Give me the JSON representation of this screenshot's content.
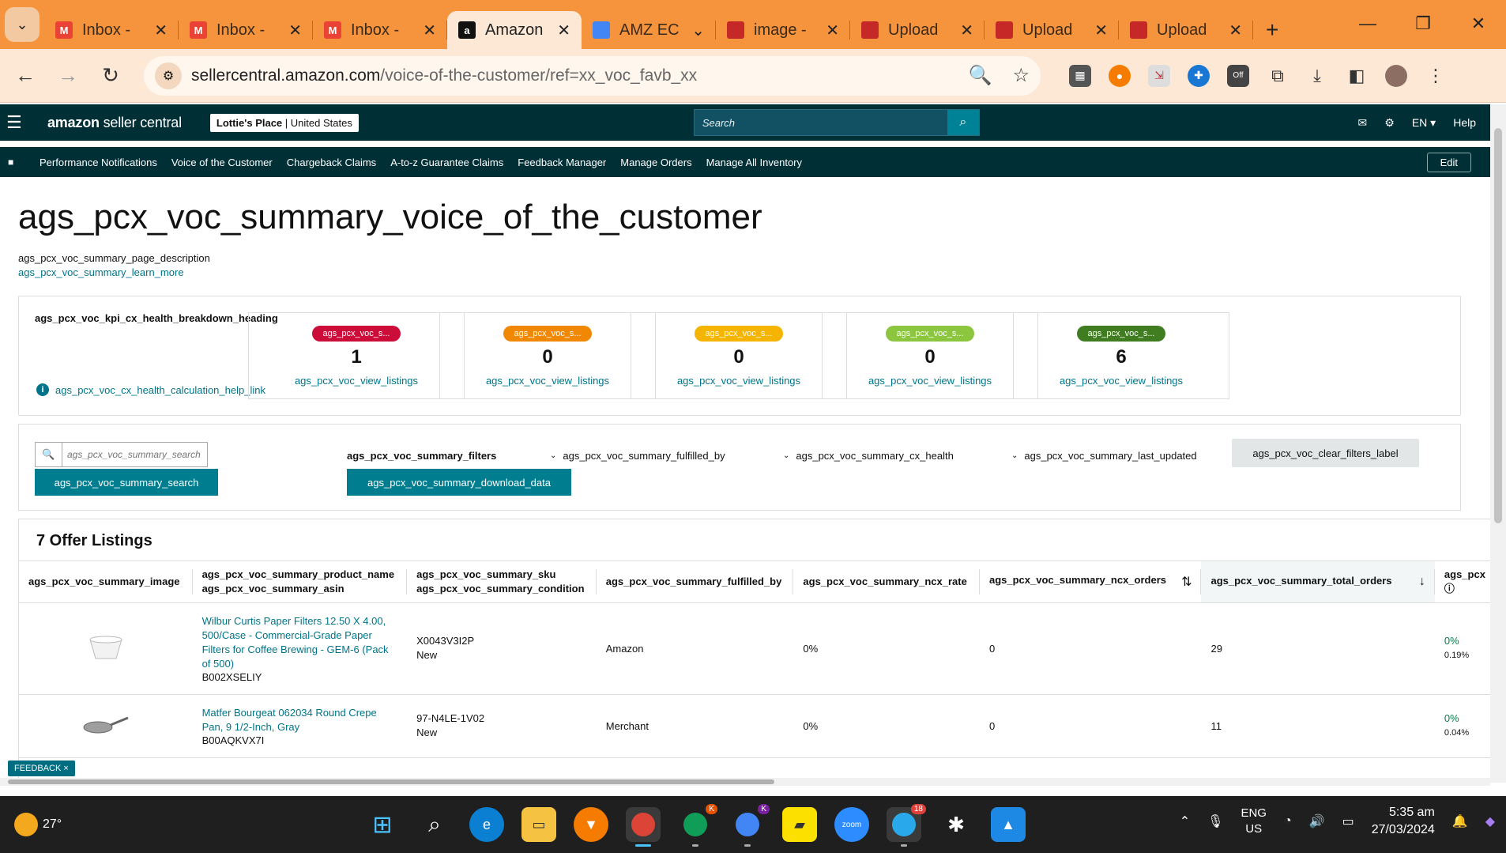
{
  "browser": {
    "tabs": [
      {
        "label": "Inbox -",
        "icon": "gmail-icon",
        "color": "#ea4335"
      },
      {
        "label": "Inbox -",
        "icon": "gmail-icon",
        "color": "#ea4335"
      },
      {
        "label": "Inbox -",
        "icon": "gmail-icon",
        "color": "#ea4335"
      },
      {
        "label": "Amazon",
        "icon": "amazon-icon",
        "color": "#111111",
        "active": true
      },
      {
        "label": "AMZ EC",
        "icon": "amz-ec-icon",
        "color": "#4285f4",
        "dropdown": true
      },
      {
        "label": "image -",
        "icon": "upload-icon",
        "color": "#c62828"
      },
      {
        "label": "Upload",
        "icon": "upload-icon",
        "color": "#c62828"
      },
      {
        "label": "Upload",
        "icon": "upload-icon",
        "color": "#c62828"
      },
      {
        "label": "Upload",
        "icon": "upload-icon",
        "color": "#c62828"
      }
    ],
    "url_host": "sellercentral.amazon.com",
    "url_path": "/voice-of-the-customer/ref=xx_voc_favb_xx"
  },
  "header": {
    "logo_bold": "amazon",
    "logo_rest": " seller central",
    "store_name": "Lottie's Place",
    "store_region": " | United States",
    "search_placeholder": "Search",
    "lang": "EN",
    "help": "Help"
  },
  "nav": {
    "links": [
      "Performance Notifications",
      "Voice of the Customer",
      "Chargeback Claims",
      "A-to-z Guarantee Claims",
      "Feedback Manager",
      "Manage Orders",
      "Manage All Inventory"
    ],
    "edit": "Edit"
  },
  "page": {
    "title": "ags_pcx_voc_summary_voice_of_the_customer",
    "description": "ags_pcx_voc_summary_page_description",
    "learn_more": "ags_pcx_voc_summary_learn_more"
  },
  "kpi": {
    "heading": "ags_pcx_voc_kpi_cx_health_breakdown_heading",
    "help_link": "ags_pcx_voc_cx_health_calculation_help_link",
    "cards": [
      {
        "pill": "ags_pcx_voc_s...",
        "color": "#cc0c39",
        "value": "1",
        "link": "ags_pcx_voc_view_listings"
      },
      {
        "pill": "ags_pcx_voc_s...",
        "color": "#f08804",
        "value": "0",
        "link": "ags_pcx_voc_view_listings"
      },
      {
        "pill": "ags_pcx_voc_s...",
        "color": "#f5b400",
        "value": "0",
        "link": "ags_pcx_voc_view_listings"
      },
      {
        "pill": "ags_pcx_voc_s...",
        "color": "#8cc63f",
        "value": "0",
        "link": "ags_pcx_voc_view_listings"
      },
      {
        "pill": "ags_pcx_voc_s...",
        "color": "#3f7d20",
        "value": "6",
        "link": "ags_pcx_voc_view_listings"
      }
    ]
  },
  "filters": {
    "search_placeholder": "ags_pcx_voc_summary_search",
    "search_button": "ags_pcx_voc_summary_search",
    "label": "ags_pcx_voc_summary_filters",
    "download": "ags_pcx_voc_summary_download_data",
    "dropdowns": [
      "ags_pcx_voc_summary_fulfilled_by",
      "ags_pcx_voc_summary_cx_health",
      "ags_pcx_voc_summary_last_updated"
    ],
    "clear": "ags_pcx_voc_clear_filters_label"
  },
  "listings": {
    "title": "7 Offer Listings",
    "columns": {
      "image": "ags_pcx_voc_summary_image",
      "product_name": "ags_pcx_voc_summary_product_name",
      "asin": "ags_pcx_voc_summary_asin",
      "sku": "ags_pcx_voc_summary_sku",
      "condition": "ags_pcx_voc_summary_condition",
      "fulfilled_by": "ags_pcx_voc_summary_fulfilled_by",
      "ncx_rate": "ags_pcx_voc_summary_ncx_rate",
      "ncx_orders": "ags_pcx_voc_summary_ncx_orders",
      "total_orders": "ags_pcx_voc_summary_total_orders",
      "next": "ags_pcx"
    },
    "rows": [
      {
        "product": "Wilbur Curtis Paper Filters 12.50 X 4.00, 500/Case - Commercial-Grade Paper Filters for Coffee Brewing - GEM-6 (Pack of 500)",
        "asin": "B002XSELIY",
        "sku": "X0043V3I2P",
        "condition": "New",
        "fulfilled_by": "Amazon",
        "ncx_rate": "0%",
        "ncx_orders": "0",
        "total_orders": "29",
        "extra_top": "0%",
        "extra_bottom": "0.19%"
      },
      {
        "product": "Matfer Bourgeat 062034 Round Crepe Pan, 9 1/2-Inch, Gray",
        "asin": "B00AQKVX7I",
        "sku": "97-N4LE-1V02",
        "condition": "New",
        "fulfilled_by": "Merchant",
        "ncx_rate": "0%",
        "ncx_orders": "0",
        "total_orders": "11",
        "extra_top": "0%",
        "extra_bottom": "0.04%"
      }
    ]
  },
  "feedback": "FEEDBACK ×",
  "taskbar": {
    "temp": "27°",
    "lang_top": "ENG",
    "lang_bottom": "US",
    "time": "5:35 am",
    "date": "27/03/2024",
    "telegram_badge": "18",
    "chrome_k1": "K",
    "chrome_k2": "K"
  }
}
